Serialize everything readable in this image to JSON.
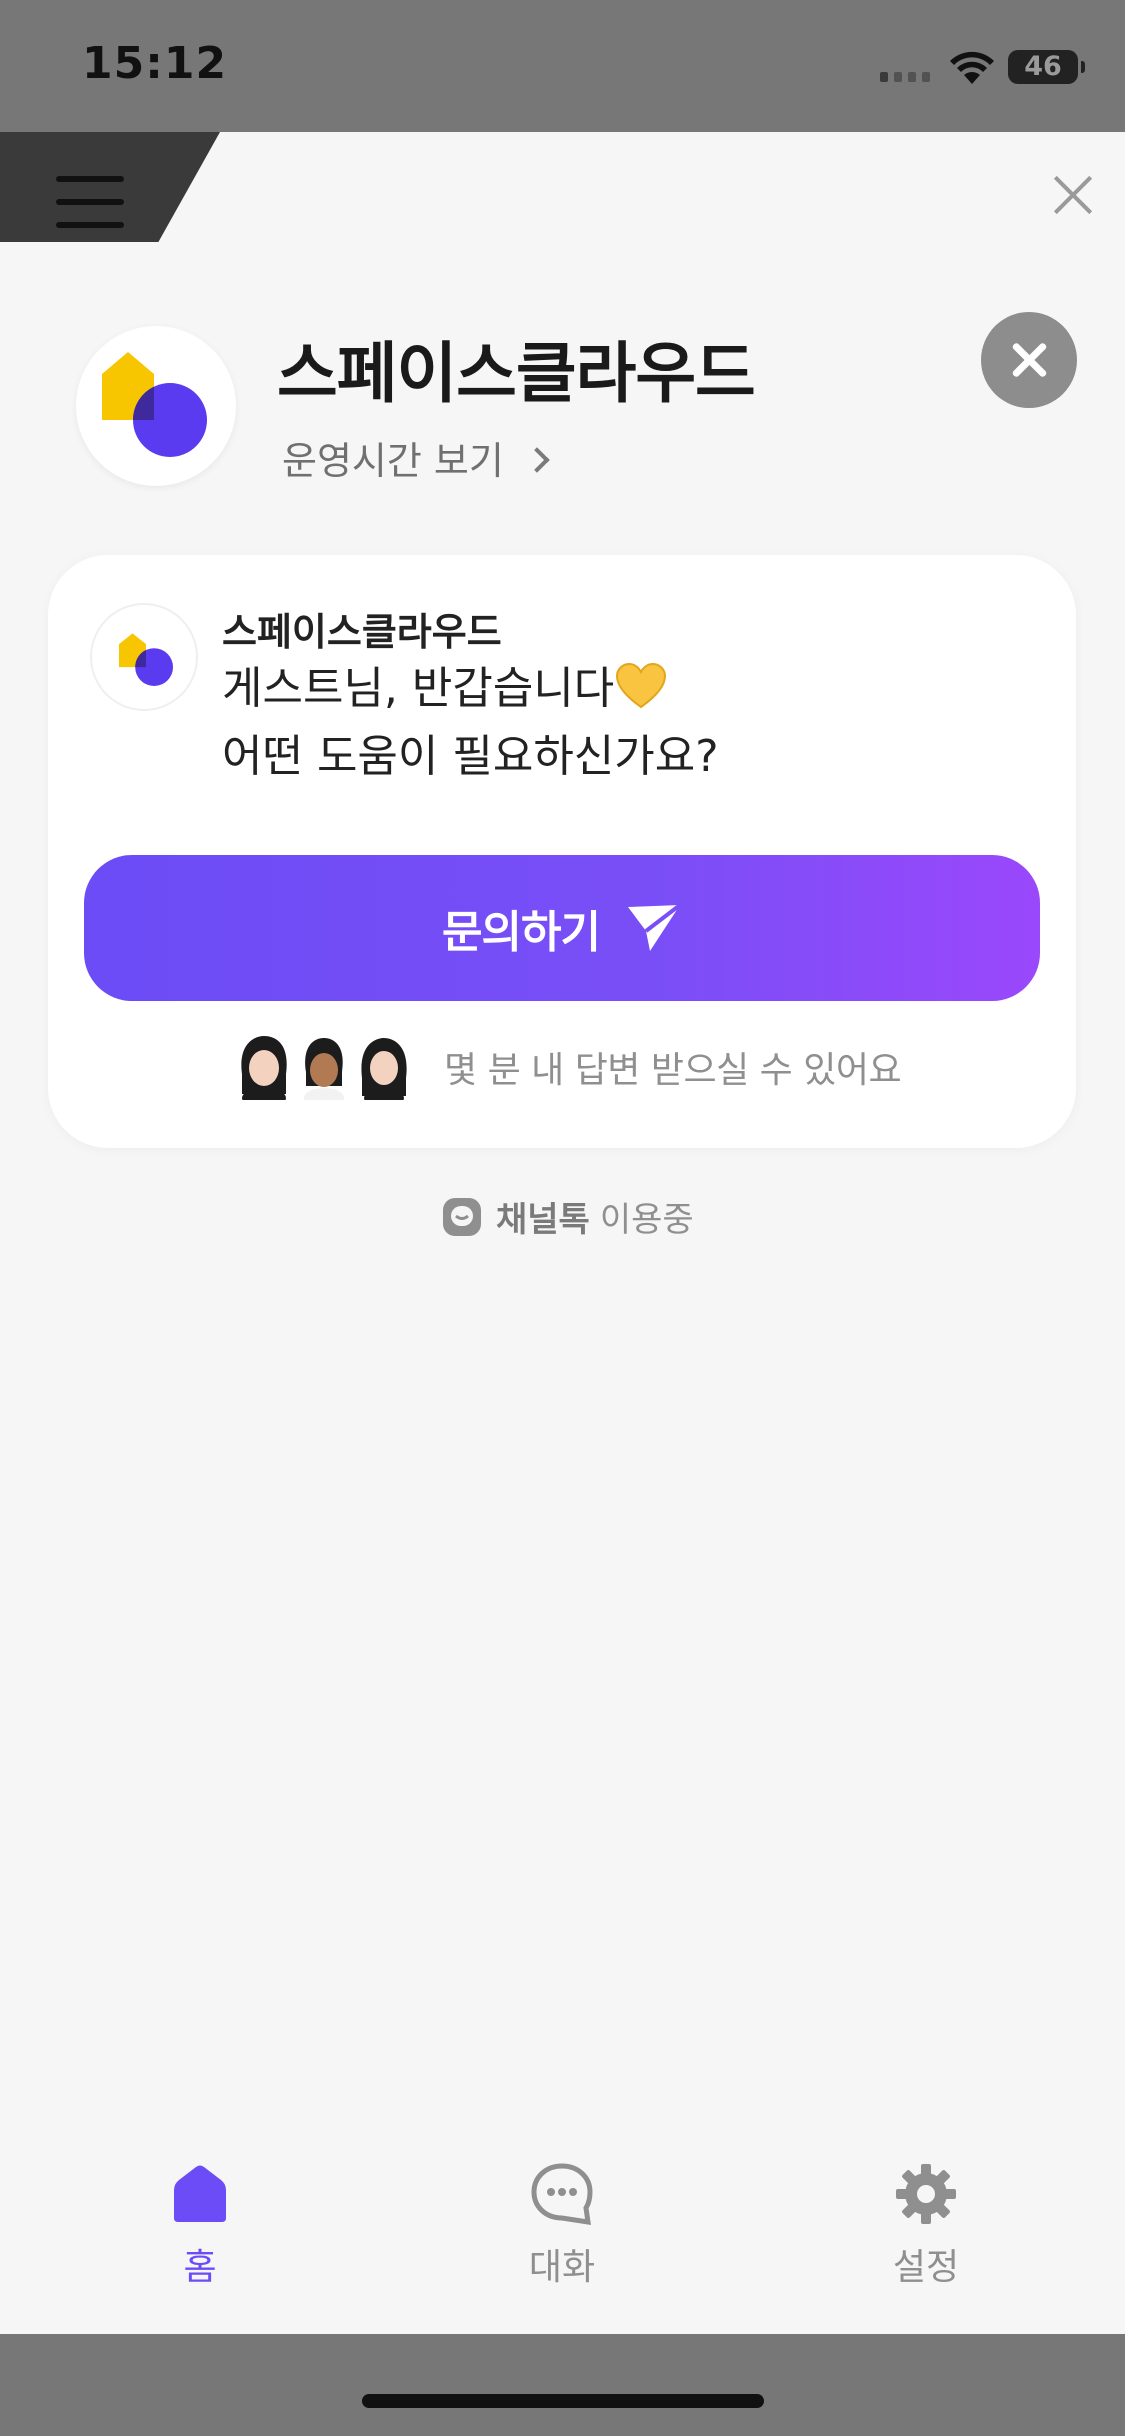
{
  "status_bar": {
    "time": "15:12",
    "battery": "46"
  },
  "browser": {
    "menu_icon": "hamburger-menu-icon",
    "close_icon": "close-icon"
  },
  "header": {
    "title": "스페이스클라우드",
    "hours_link": "운영시간 보기"
  },
  "card": {
    "sender": "스페이스클라우드",
    "greeting_line1": "게스트님, 반갑습니다",
    "greeting_line2": "어떤 도움이 필요하신가요?",
    "button_label": "문의하기",
    "reply_time": "몇 분 내 답변 받으실 수 있어요"
  },
  "footer_note": {
    "brand": "채널톡",
    "suffix": "이용중"
  },
  "bottom_nav": {
    "items": [
      {
        "label": "홈",
        "icon": "home-icon",
        "active": true
      },
      {
        "label": "대화",
        "icon": "chat-bubble-icon",
        "active": false
      },
      {
        "label": "설정",
        "icon": "gear-icon",
        "active": false
      }
    ]
  },
  "colors": {
    "accent": "#6b4cf6",
    "accent_end": "#9a48fb",
    "logo_yellow": "#f7c600",
    "logo_purple": "#5b3bf0",
    "inactive": "#8f8f8f"
  }
}
